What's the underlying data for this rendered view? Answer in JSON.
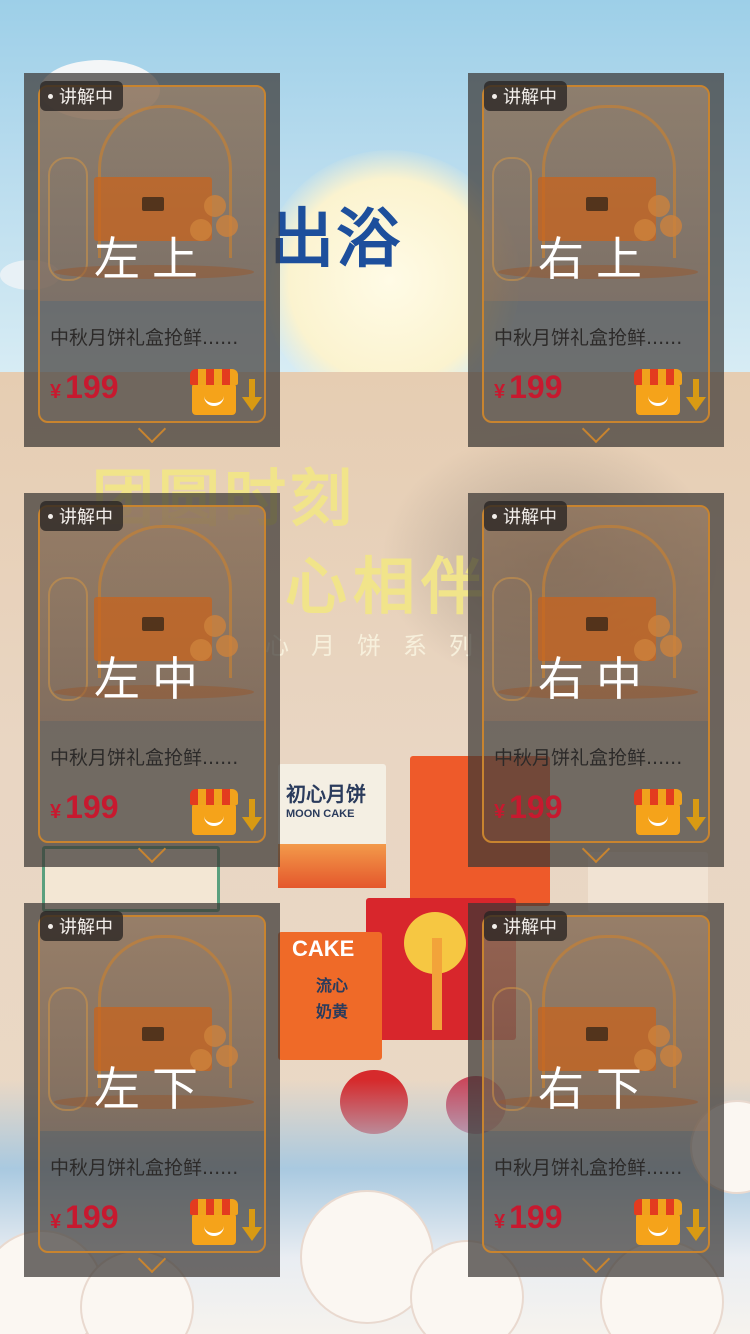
{
  "background": {
    "title": "出浴",
    "slogan_line1": "团圆时刻",
    "slogan_line2": "心相伴",
    "series": "心月饼系列",
    "box_brand_1": "初心月饼",
    "box_brand_2": "MOON CAKE",
    "box_cake": "CAKE",
    "box_flavor": "流心奶黄"
  },
  "cards": [
    {
      "tag": "讲解中",
      "position_label": "左上",
      "title": "中秋月饼礼盒抢鲜......",
      "currency": "¥",
      "price": "199"
    },
    {
      "tag": "讲解中",
      "position_label": "右上",
      "title": "中秋月饼礼盒抢鲜......",
      "currency": "¥",
      "price": "199"
    },
    {
      "tag": "讲解中",
      "position_label": "左中",
      "title": "中秋月饼礼盒抢鲜......",
      "currency": "¥",
      "price": "199"
    },
    {
      "tag": "讲解中",
      "position_label": "右中",
      "title": "中秋月饼礼盒抢鲜......",
      "currency": "¥",
      "price": "199"
    },
    {
      "tag": "讲解中",
      "position_label": "左下",
      "title": "中秋月饼礼盒抢鲜......",
      "currency": "¥",
      "price": "199"
    },
    {
      "tag": "讲解中",
      "position_label": "右下",
      "title": "中秋月饼礼盒抢鲜......",
      "currency": "¥",
      "price": "199"
    }
  ],
  "icons": {
    "cart": "shop-cart-icon",
    "download": "arrow-down-icon",
    "live": "live-dot-icon"
  },
  "colors": {
    "price": "#c7192f",
    "card_border": "#c8842f",
    "overlay": "#3c3734"
  }
}
